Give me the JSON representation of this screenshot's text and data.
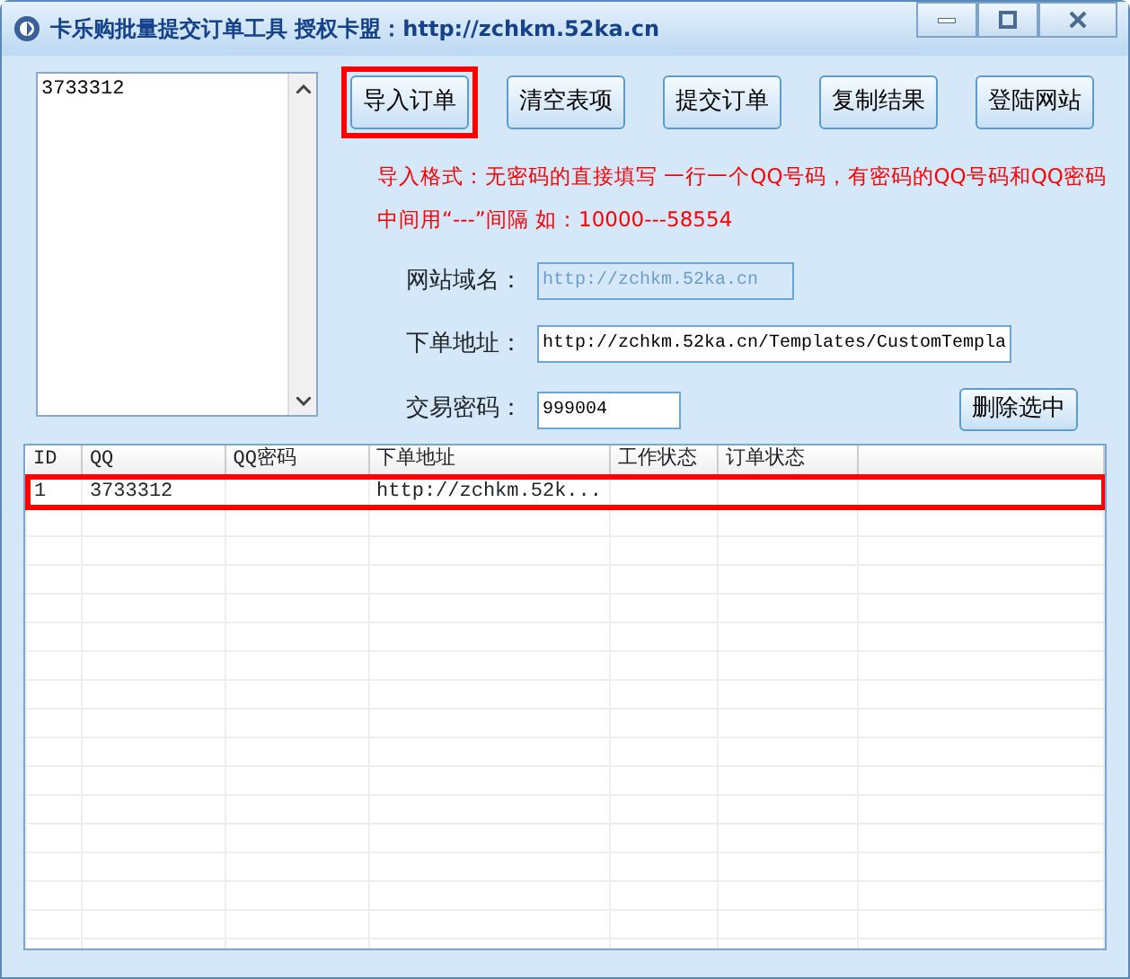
{
  "window": {
    "title": "卡乐购批量提交订单工具 授权卡盟：http://zchkm.52ka.cn"
  },
  "order_list": {
    "value": "3733312"
  },
  "buttons": [
    {
      "label": "导入订单",
      "highlighted": true
    },
    {
      "label": "清空表项",
      "highlighted": false
    },
    {
      "label": "提交订单",
      "highlighted": false
    },
    {
      "label": "复制结果",
      "highlighted": false
    },
    {
      "label": "登陆网站",
      "highlighted": false
    }
  ],
  "hint": [
    "导入格式：无密码的直接填写 一行一个QQ号码，有密码的QQ号码和QQ密码",
    "中间用“---”间隔 如：10000---58554"
  ],
  "fields": [
    {
      "label": "网站域名：",
      "value": "http://zchkm.52ka.cn",
      "disabled": true
    },
    {
      "label": "下单地址：",
      "value": "http://zchkm.52ka.cn/Templates/CustomTempla",
      "disabled": false
    },
    {
      "label": "交易密码：",
      "value": "999004",
      "disabled": false
    }
  ],
  "delete_button": "删除选中",
  "table": {
    "columns": [
      "ID",
      "QQ",
      "QQ密码",
      "下单地址",
      "工作状态",
      "订单状态"
    ],
    "rows": [
      {
        "cells": [
          "1",
          "3733312",
          "",
          "http://zchkm.52k...",
          "",
          ""
        ],
        "highlighted": true
      }
    ]
  }
}
